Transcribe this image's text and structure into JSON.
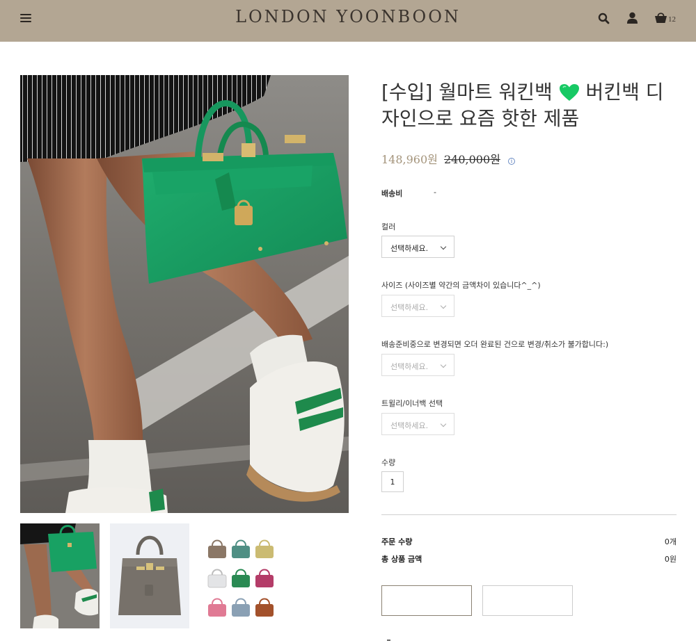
{
  "header": {
    "logo": "LONDON YOONBOON",
    "cart_count": "12",
    "icons": [
      "menu-icon",
      "search-icon",
      "user-icon",
      "cart-icon"
    ],
    "background": "#b3a693"
  },
  "product": {
    "title": "[수입] 월마트 워킨백 💚 버킨백 디자인으로 요즘 핫한 제품",
    "title_line1": "[수입] 월마트 워킨백",
    "title_line2": "버킨백",
    "title_line3": "디자인으로 요즘 핫한 제품",
    "sale_price": "148,960원",
    "original_price": "240,000원",
    "accent_color": "#a4947b",
    "images": [
      "main-image",
      "thumbnail-1",
      "thumbnail-2",
      "thumbnail-3"
    ]
  },
  "shipping": {
    "label": "배송비",
    "value": "-"
  },
  "options": [
    {
      "label": "컬러",
      "selected": "선택하세요.",
      "enabled": true
    },
    {
      "label": "사이즈 (사이즈별 약간의 금액차이 있습니다^_^)",
      "selected": "선택하세요.",
      "enabled": false
    },
    {
      "label": "배송준비중으로 변경되면 오더 완료된 건으로 변경/취소가 불가합니다:)",
      "selected": "선택하세요.",
      "enabled": false
    },
    {
      "label": "트윌리/이너백 선택",
      "selected": "선택하세요.",
      "enabled": false
    }
  ],
  "quantity": {
    "label": "수량",
    "value": "1"
  },
  "summary": {
    "order_qty_label": "주문 수량",
    "order_qty_value": "0개",
    "total_label": "총 상품 금액",
    "total_value": "0원"
  }
}
